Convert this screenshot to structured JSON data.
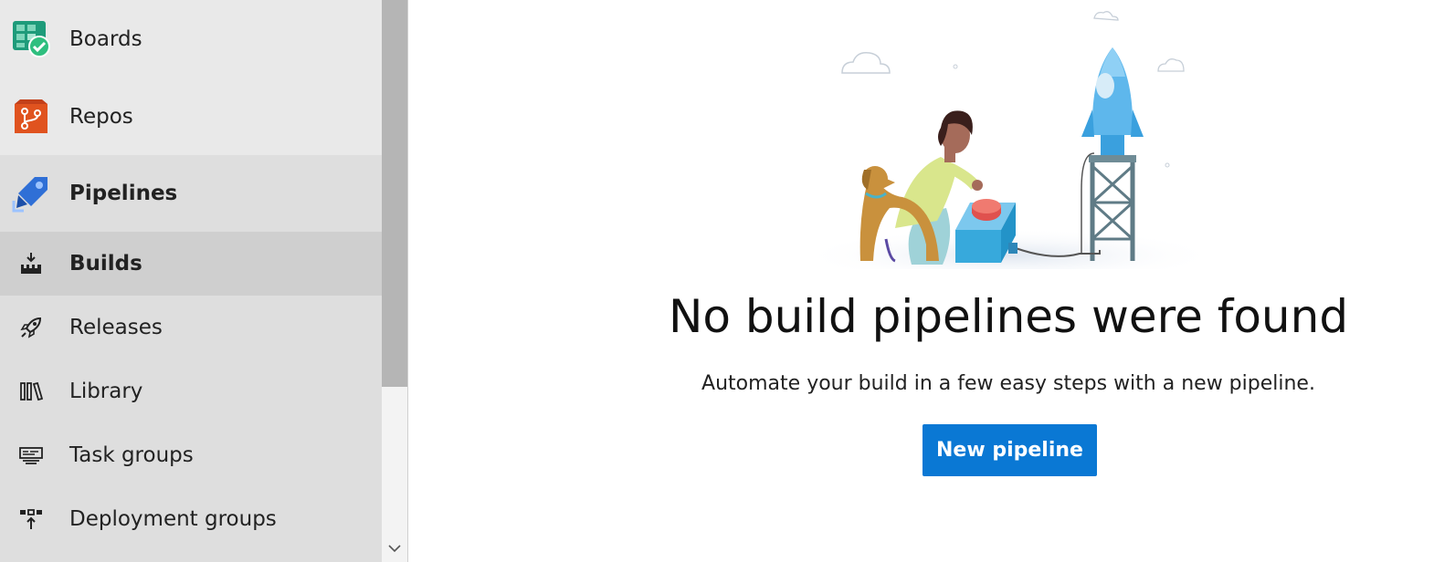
{
  "sidebar": {
    "items": [
      {
        "label": "Boards",
        "icon": "boards-icon"
      },
      {
        "label": "Repos",
        "icon": "repos-icon"
      },
      {
        "label": "Pipelines",
        "icon": "pipelines-icon"
      },
      {
        "label": "Builds",
        "icon": "builds-icon"
      },
      {
        "label": "Releases",
        "icon": "releases-icon"
      },
      {
        "label": "Library",
        "icon": "library-icon"
      },
      {
        "label": "Task groups",
        "icon": "task-groups-icon"
      },
      {
        "label": "Deployment groups",
        "icon": "deployment-groups-icon"
      }
    ],
    "selected": "Builds"
  },
  "main": {
    "headline": "No build pipelines were found",
    "subtext": "Automate your build in a few easy steps with a new pipeline.",
    "cta_label": "New pipeline"
  },
  "colors": {
    "accent": "#0a78d4",
    "sidebar_bg": "#dedede",
    "selected_bg": "#cfcfcf"
  }
}
